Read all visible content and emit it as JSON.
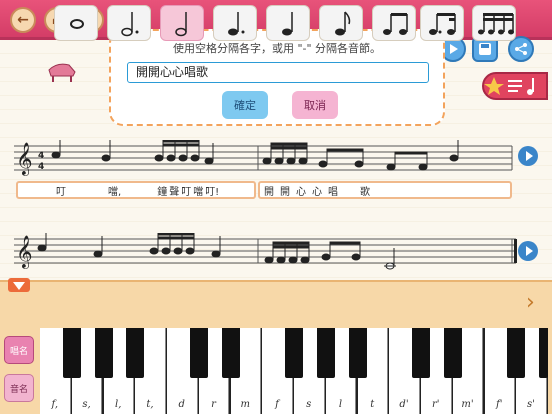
{
  "toolbar": {
    "back": "←",
    "home": "⌂",
    "help": "?"
  },
  "dialog": {
    "message": "使用空格分隔各字，或用 \"-\" 分隔各音節。",
    "input_value": "開開心心唱歌",
    "ok_label": "確定",
    "cancel_label": "取消"
  },
  "staff1": {
    "time_sig_top": "4",
    "time_sig_bottom": "4",
    "lyrics_left": [
      "叮",
      "噹,",
      "鐘",
      "聲",
      "叮",
      "噹",
      "叮!"
    ],
    "lyrics_right": [
      "開",
      "開",
      "心",
      "心",
      "唱",
      "歌"
    ]
  },
  "durations": [
    "whole",
    "dotted-half",
    "half",
    "dotted-quarter",
    "quarter",
    "eighth",
    "two-eighths",
    "dotted-eighth-sixteenth",
    "four-sixteenths"
  ],
  "side_buttons": {
    "a": "唱名",
    "b": "音名"
  },
  "keys": [
    "f,",
    "s,",
    "l,",
    "t,",
    "d",
    "r",
    "m",
    "f",
    "s",
    "l",
    "t",
    "d'",
    "r'",
    "m'",
    "f'",
    "s'"
  ],
  "colors": {
    "accent": "#d43d67",
    "dialog_border": "#f3a35c"
  }
}
